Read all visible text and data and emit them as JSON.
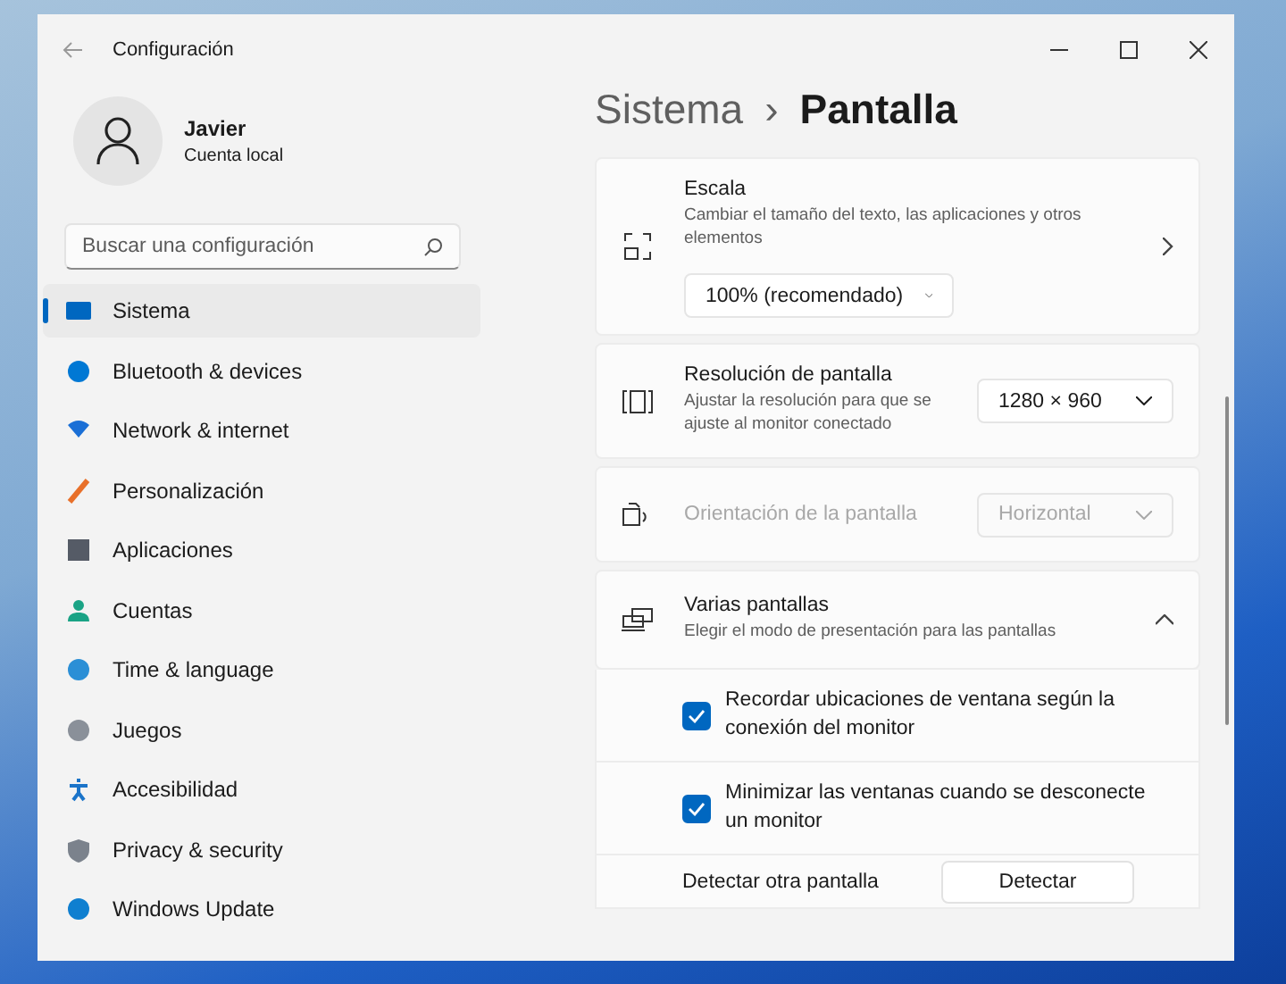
{
  "window": {
    "title": "Configuración"
  },
  "user": {
    "name": "Javier",
    "account": "Cuenta local"
  },
  "search": {
    "placeholder": "Buscar una configuración"
  },
  "nav": [
    {
      "label": "Sistema",
      "selected": true
    },
    {
      "label": "Bluetooth & devices",
      "selected": false
    },
    {
      "label": "Network & internet",
      "selected": false
    },
    {
      "label": "Personalización",
      "selected": false
    },
    {
      "label": "Aplicaciones",
      "selected": false
    },
    {
      "label": "Cuentas",
      "selected": false
    },
    {
      "label": "Time & language",
      "selected": false
    },
    {
      "label": "Juegos",
      "selected": false
    },
    {
      "label": "Accesibilidad",
      "selected": false
    },
    {
      "label": "Privacy & security",
      "selected": false
    },
    {
      "label": "Windows Update",
      "selected": false
    }
  ],
  "breadcrumb": {
    "parent": "Sistema",
    "separator": "›",
    "current": "Pantalla"
  },
  "settings": [
    {
      "kind": "scale",
      "title": "Escala",
      "description": "Cambiar el tamaño del texto, las aplicaciones y otros elementos",
      "dropdown": "100% (recomendado)"
    },
    {
      "kind": "select",
      "title": "Resolución de pantalla",
      "description": "Ajustar la resolución para que se ajuste al monitor conectado",
      "dropdown": "1280 × 960",
      "disabled": false
    },
    {
      "kind": "select",
      "title": "Orientación de la pantalla",
      "dropdown": "Horizontal",
      "disabled": true
    },
    {
      "kind": "group",
      "title": "Varias pantallas",
      "description": "Elegir el modo de presentación para las pantallas",
      "expanded": true,
      "options": [
        {
          "label": "Recordar ubicaciones de ventana según la conexión del monitor",
          "checked": true
        },
        {
          "label": "Minimizar las ventanas cuando se desconecte un monitor",
          "checked": true
        }
      ],
      "detect": {
        "label": "Detectar otra pantalla",
        "button": "Detectar"
      }
    }
  ]
}
